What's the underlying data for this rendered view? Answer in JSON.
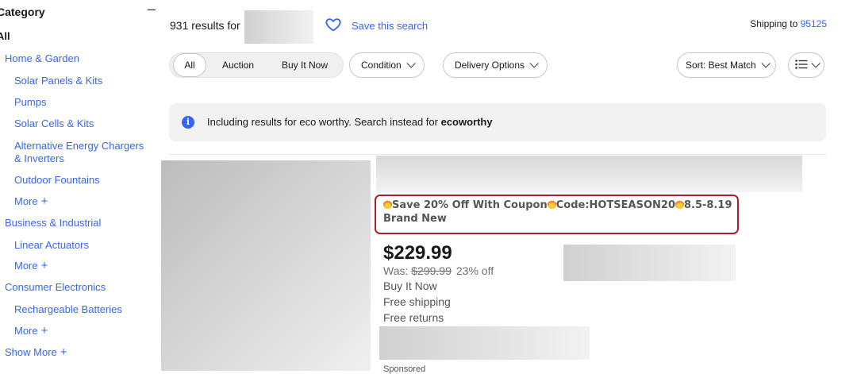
{
  "sidebar": {
    "title": "Category",
    "collapse_symbol": "–",
    "all_label": "All",
    "items": [
      {
        "label": "Home & Garden",
        "level": 1
      },
      {
        "label": "Solar Panels & Kits",
        "level": 2
      },
      {
        "label": "Pumps",
        "level": 2
      },
      {
        "label": "Solar Cells & Kits",
        "level": 2
      },
      {
        "label": "Alternative Energy Chargers",
        "level": 2
      },
      {
        "label": "& Inverters",
        "level": 2
      },
      {
        "label": "Outdoor Fountains",
        "level": 2
      },
      {
        "label": "More",
        "level": 2
      },
      {
        "label": "Business & Industrial",
        "level": 1
      },
      {
        "label": "Linear Actuators",
        "level": 2
      },
      {
        "label": "More",
        "level": 2
      },
      {
        "label": "Consumer Electronics",
        "level": 1
      },
      {
        "label": "Rechargeable Batteries",
        "level": 2
      },
      {
        "label": "More",
        "level": 2
      },
      {
        "label": "Show More",
        "level": 1
      }
    ],
    "plus_symbol": "+"
  },
  "header": {
    "results_text": "931 results for",
    "save_search": "Save this search",
    "shipping_prefix": "Shipping to",
    "zip": "95125"
  },
  "filters": {
    "segments": [
      "All",
      "Auction",
      "Buy It Now"
    ],
    "condition": "Condition",
    "delivery": "Delivery Options",
    "sort": "Sort: Best Match",
    "view_icon": "list-view-icon"
  },
  "banner": {
    "text_prefix": "Including results for eco worthy. Search instead for",
    "alt_query": "ecoworthy",
    "icon": "info-icon"
  },
  "item": {
    "subtitle_parts": [
      "Save 20% Off With Coupon",
      "Code:HOTSEASON20",
      "8.5-8.19"
    ],
    "condition": "Brand New",
    "price": "$229.99",
    "was_label": "Was:",
    "was_price": "$299.99",
    "discount": "23% off",
    "buy_format": "Buy It Now",
    "shipping": "Free shipping",
    "returns": "Free returns",
    "sponsored": "Sponsored"
  },
  "colors": {
    "link": "#3665f3",
    "highlight_border": "#b01e25"
  }
}
